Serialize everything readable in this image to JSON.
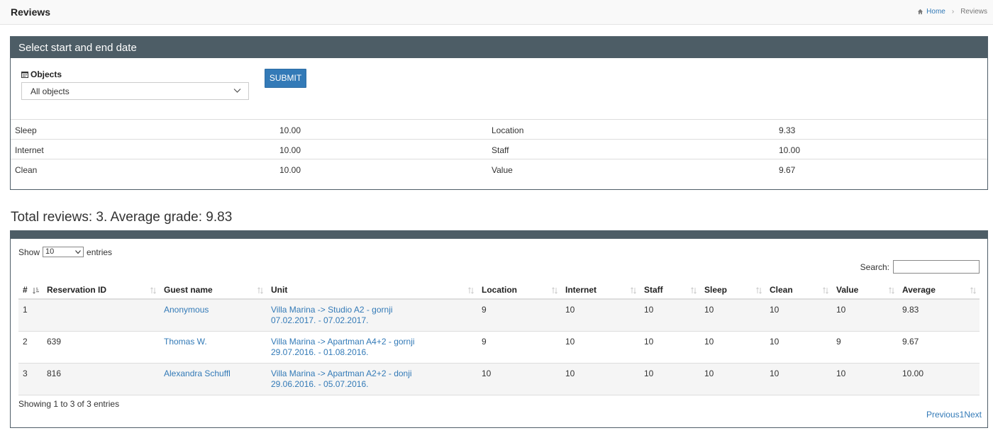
{
  "page": {
    "title": "Reviews"
  },
  "breadcrumb": {
    "home": "Home",
    "current": "Reviews"
  },
  "filter_panel": {
    "heading": "Select start and end date",
    "objects_label": "Objects",
    "objects_selected": "All objects",
    "submit_label": "SUBMIT"
  },
  "stats": [
    {
      "label": "Sleep",
      "value": "10.00",
      "label2": "Location",
      "value2": "9.33"
    },
    {
      "label": "Internet",
      "value": "10.00",
      "label2": "Staff",
      "value2": "10.00"
    },
    {
      "label": "Clean",
      "value": "10.00",
      "label2": "Value",
      "value2": "9.67"
    }
  ],
  "summary": "Total reviews: 3. Average grade: 9.83",
  "table_controls": {
    "show": "Show",
    "length": "10",
    "entries": "entries",
    "search": "Search:"
  },
  "columns": [
    "#",
    "Reservation ID",
    "Guest name",
    "Unit",
    "Location",
    "Internet",
    "Staff",
    "Sleep",
    "Clean",
    "Value",
    "Average"
  ],
  "rows": [
    {
      "num": "1",
      "res_id": "",
      "guest": "Anonymous",
      "unit": "Villa Marina -> Studio A2 - gornji",
      "dates": "07.02.2017. - 07.02.2017.",
      "location": "9",
      "internet": "10",
      "staff": "10",
      "sleep": "10",
      "clean": "10",
      "value": "10",
      "average": "9.83"
    },
    {
      "num": "2",
      "res_id": "639",
      "guest": "Thomas W.",
      "unit": "Villa Marina -> Apartman A4+2 - gornji",
      "dates": "29.07.2016. - 01.08.2016.",
      "location": "9",
      "internet": "10",
      "staff": "10",
      "sleep": "10",
      "clean": "10",
      "value": "9",
      "average": "9.67"
    },
    {
      "num": "3",
      "res_id": "816",
      "guest": "Alexandra Schuffl",
      "unit": "Villa Marina -> Apartman A2+2 - donji",
      "dates": "29.06.2016. - 05.07.2016.",
      "location": "10",
      "internet": "10",
      "staff": "10",
      "sleep": "10",
      "clean": "10",
      "value": "10",
      "average": "10.00"
    }
  ],
  "footer": {
    "info": "Showing 1 to 3 of 3 entries",
    "previous": "Previous",
    "page": "1",
    "next": "Next"
  },
  "colors": {
    "panel_header": "#4d5d66",
    "link": "#337ab7",
    "button": "#337ab7"
  },
  "icons": {
    "home": "home-icon",
    "calendar": "calendar-icon",
    "sort": "sort-icon"
  }
}
